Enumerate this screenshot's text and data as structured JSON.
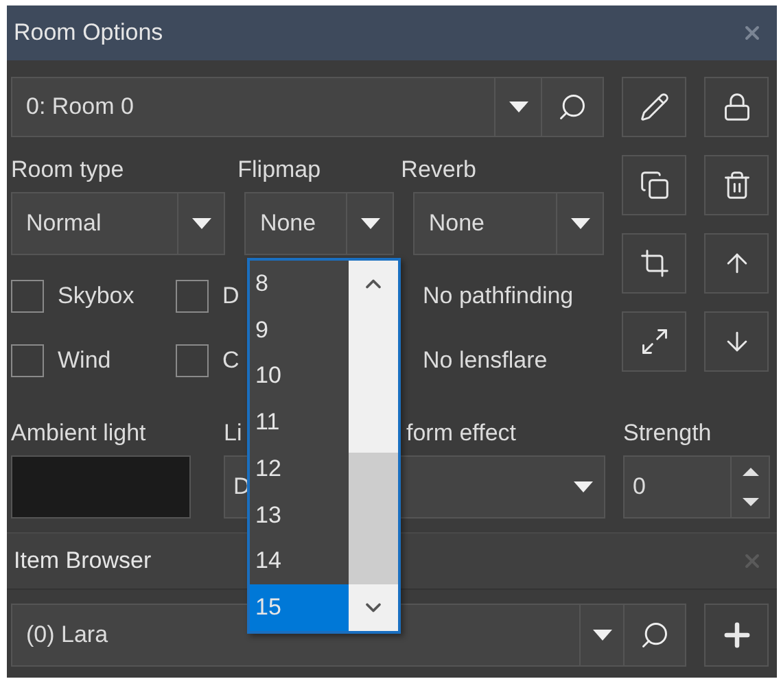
{
  "window": {
    "title": "Room Options"
  },
  "room_selector": {
    "value": "0: Room 0"
  },
  "fields": [
    {
      "label": "Room type",
      "value": "Normal"
    },
    {
      "label": "Flipmap",
      "value": "None"
    },
    {
      "label": "Reverb",
      "value": "None"
    }
  ],
  "flag_rows": [
    [
      {
        "kind": "checkbox",
        "label": "Skybox",
        "checked": false
      },
      {
        "kind": "checkbox",
        "label": "D",
        "checked": false
      },
      {
        "kind": "text",
        "label": "No pathfinding"
      }
    ],
    [
      {
        "kind": "checkbox",
        "label": "Wind",
        "checked": false
      },
      {
        "kind": "checkbox",
        "label": "C",
        "checked": false
      },
      {
        "kind": "text",
        "label": "No lensflare"
      }
    ]
  ],
  "lighting": {
    "ambient_label": "Ambient light",
    "light_label": "Li",
    "light_value": "D",
    "effect_label": "form effect",
    "strength_label": "Strength",
    "strength_value": "0"
  },
  "item_browser": {
    "title": "Item Browser",
    "value": "(0) Lara"
  },
  "flipmap_list": {
    "items": [
      {
        "label": "8",
        "selected": false
      },
      {
        "label": "9",
        "selected": false
      },
      {
        "label": "10",
        "selected": false
      },
      {
        "label": "11",
        "selected": false
      },
      {
        "label": "12",
        "selected": false
      },
      {
        "label": "13",
        "selected": false
      },
      {
        "label": "14",
        "selected": false
      },
      {
        "label": "15",
        "selected": true
      }
    ]
  }
}
